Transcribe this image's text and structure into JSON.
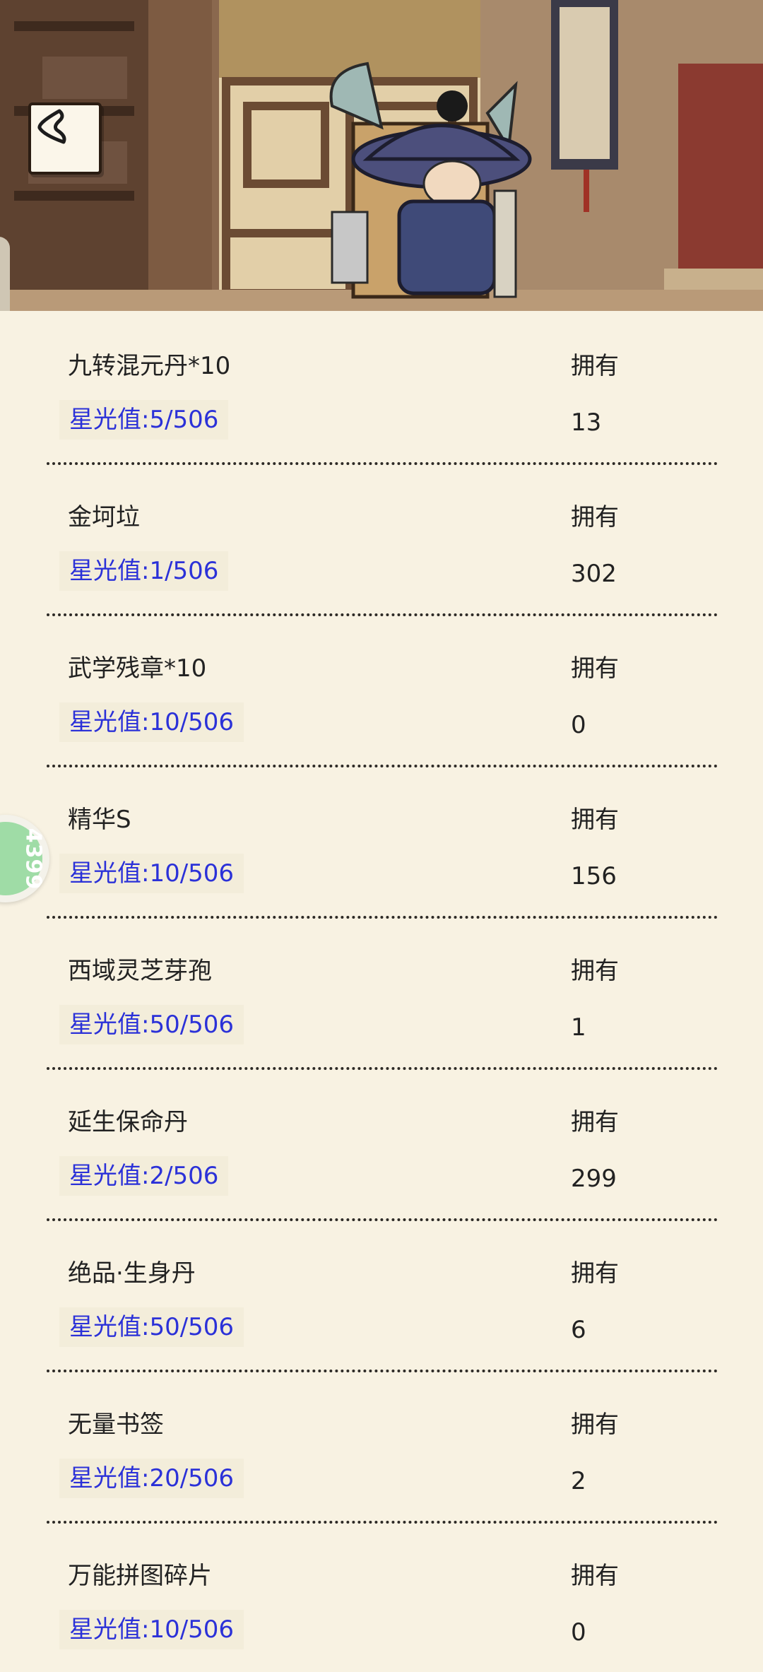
{
  "header": {
    "back_icon": "chevron-left-icon",
    "character": "merchant-with-backpack-illustration"
  },
  "badge": {
    "text": "4399",
    "color": "#9fdca6"
  },
  "colors": {
    "background": "#f8f2e2",
    "starlight": "#2b31d8",
    "text": "#222222"
  },
  "items": [
    {
      "name": "九转混元丹*10",
      "own_label": "拥有",
      "starlight": "星光值:5/506",
      "count": "13"
    },
    {
      "name": "金坷垃",
      "own_label": "拥有",
      "starlight": "星光值:1/506",
      "count": "302"
    },
    {
      "name": "武学残章*10",
      "own_label": "拥有",
      "starlight": "星光值:10/506",
      "count": "0"
    },
    {
      "name": "精华S",
      "own_label": "拥有",
      "starlight": "星光值:10/506",
      "count": "156"
    },
    {
      "name": "西域灵芝芽孢",
      "own_label": "拥有",
      "starlight": "星光值:50/506",
      "count": "1"
    },
    {
      "name": "延生保命丹",
      "own_label": "拥有",
      "starlight": "星光值:2/506",
      "count": "299"
    },
    {
      "name": "绝品·生身丹",
      "own_label": "拥有",
      "starlight": "星光值:50/506",
      "count": "6"
    },
    {
      "name": "无量书签",
      "own_label": "拥有",
      "starlight": "星光值:20/506",
      "count": "2"
    },
    {
      "name": "万能拼图碎片",
      "own_label": "拥有",
      "starlight": "星光值:10/506",
      "count": "0"
    }
  ]
}
